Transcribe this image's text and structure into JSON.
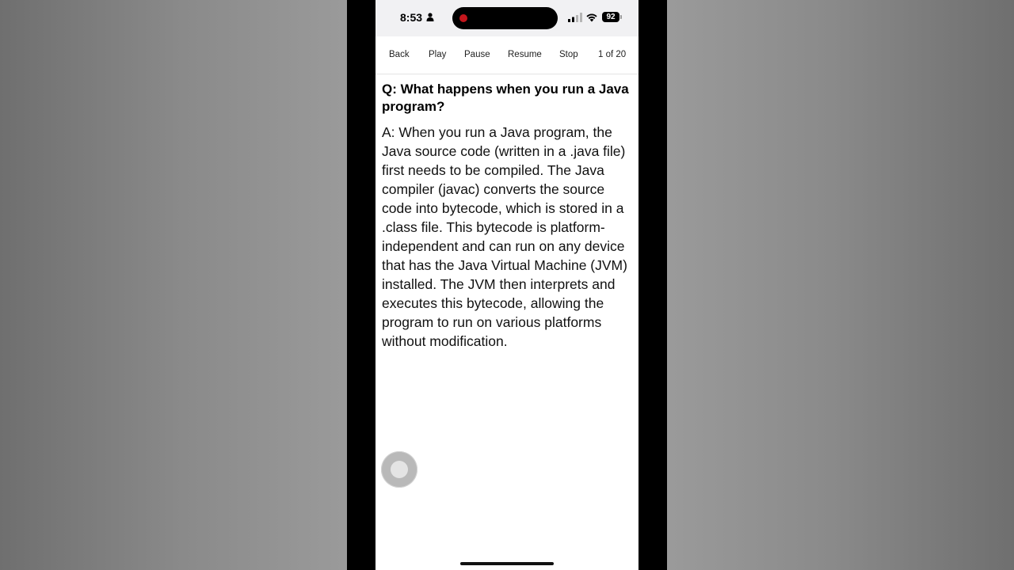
{
  "status_bar": {
    "time": "8:53",
    "battery": "92",
    "icons": [
      "person-icon",
      "recording-dot-icon",
      "cellular-signal-icon",
      "wifi-icon",
      "battery-icon"
    ]
  },
  "toolbar": {
    "back_label": "Back",
    "play_label": "Play",
    "pause_label": "Pause",
    "resume_label": "Resume",
    "stop_label": "Stop",
    "counter": "1 of 20"
  },
  "card": {
    "question": "Q: What happens when you run a Java program?",
    "answer": "A: When you run a Java program, the Java source code (written in a .java file) first needs to be compiled. The Java compiler (javac) converts the source code into bytecode, which is stored in a .class file. This bytecode is platform-independent and can run on any device that has the Java Virtual Machine (JVM) installed. The JVM then interprets and executes this bytecode, allowing the program to run on various platforms without modification."
  },
  "colors": {
    "recording_dot": "#c4161c",
    "screen_background": "#ffffff",
    "status_bar_background": "#f1f1f3"
  }
}
